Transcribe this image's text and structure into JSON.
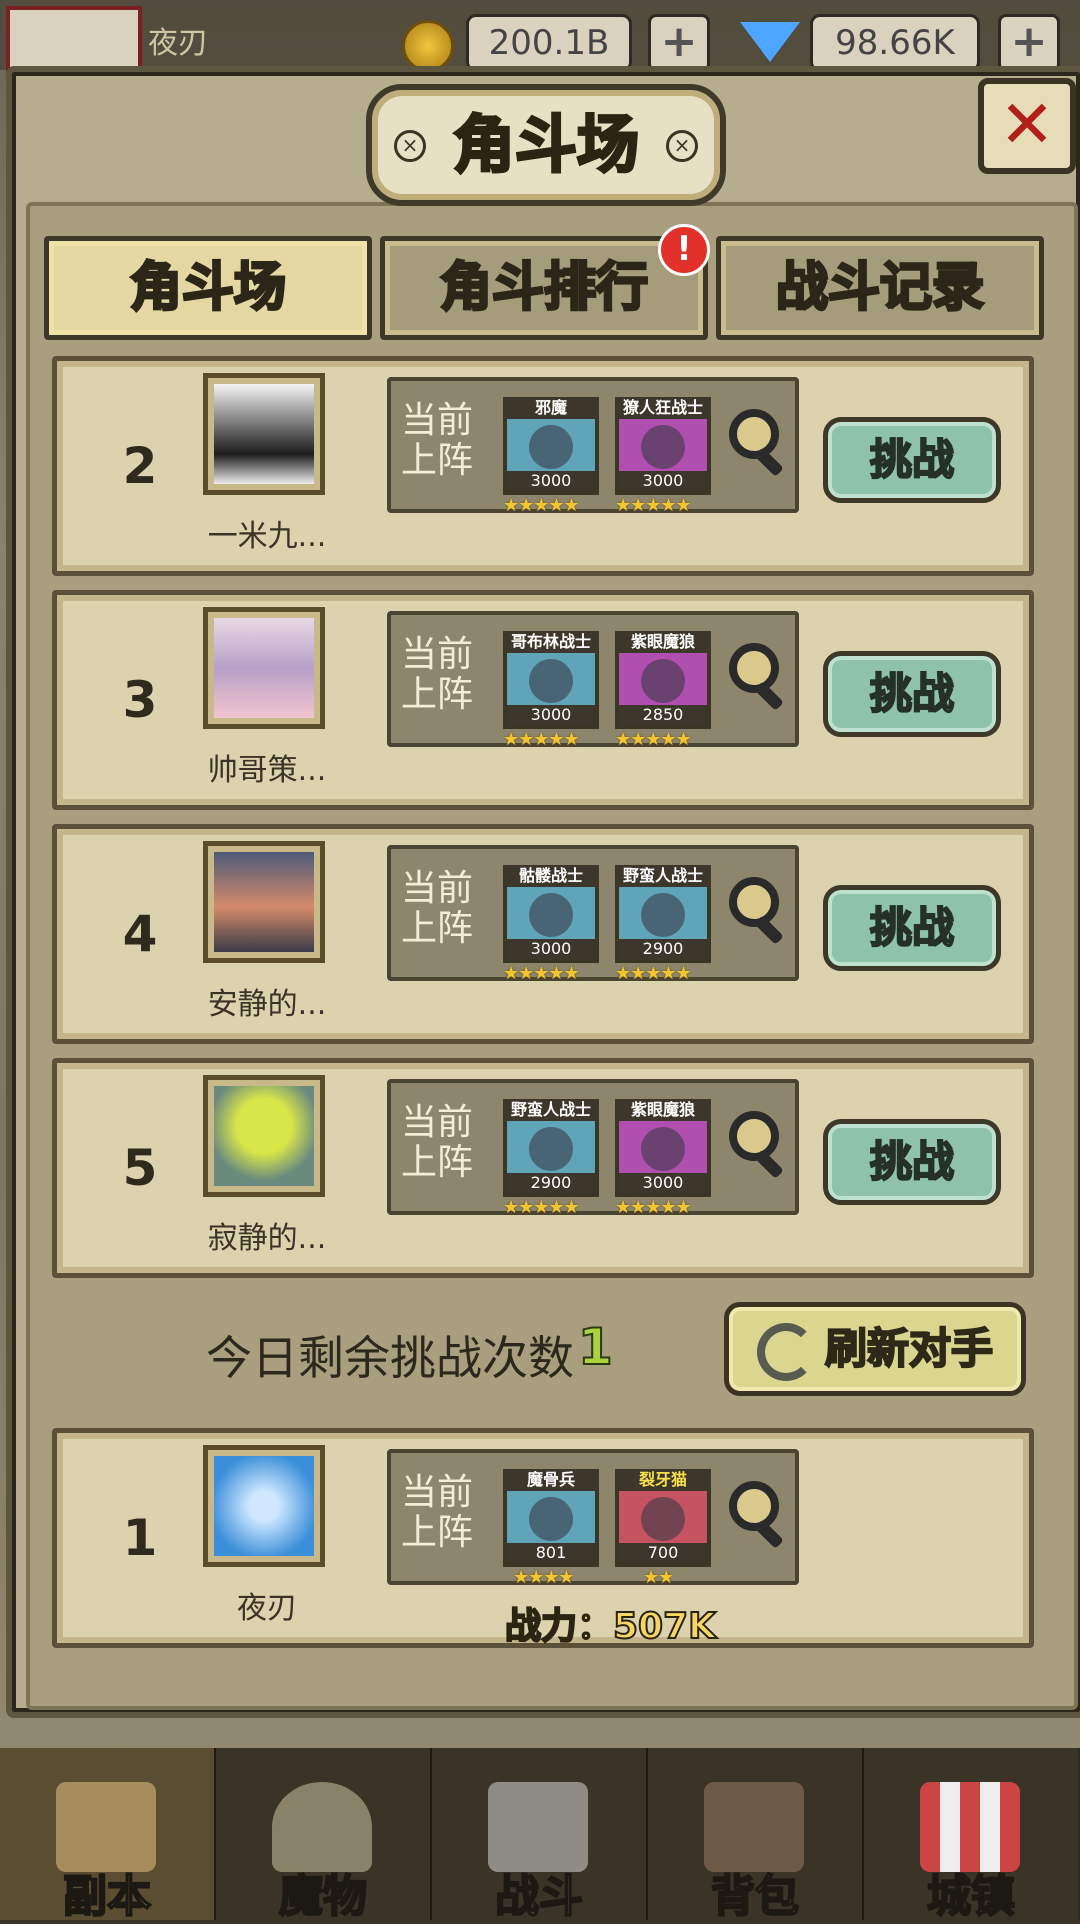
{
  "hud": {
    "player_name": "夜刃",
    "gold": "200.1B",
    "gems": "98.66K",
    "plus": "+",
    "gold_color": "#f2c63d",
    "gem_color": "#4da6ff"
  },
  "panel": {
    "title": "角斗场",
    "close_label": "✕",
    "title_dot": "×"
  },
  "tabs": [
    {
      "label": "角斗场",
      "active": true
    },
    {
      "label": "角斗排行",
      "active": false,
      "badge": "!"
    },
    {
      "label": "战斗记录",
      "active": false
    }
  ],
  "lineup_label": "当前上阵",
  "challenge_label": "挑战",
  "opponents": [
    {
      "rank": "2",
      "name": "一米九...",
      "units": [
        {
          "name": "邪魔",
          "power": "3000",
          "stars": "★★★★★"
        },
        {
          "name": "獠人狂战士",
          "power": "3000",
          "stars": "★★★★★"
        }
      ]
    },
    {
      "rank": "3",
      "name": "帅哥策...",
      "units": [
        {
          "name": "哥布林战士",
          "power": "3000",
          "stars": "★★★★★"
        },
        {
          "name": "紫眼魔狼",
          "power": "2850",
          "stars": "★★★★★"
        }
      ]
    },
    {
      "rank": "4",
      "name": "安静的...",
      "units": [
        {
          "name": "骷髅战士",
          "power": "3000",
          "stars": "★★★★★"
        },
        {
          "name": "野蛮人战士",
          "power": "2900",
          "stars": "★★★★★"
        }
      ]
    },
    {
      "rank": "5",
      "name": "寂静的...",
      "units": [
        {
          "name": "野蛮人战士",
          "power": "2900",
          "stars": "★★★★★"
        },
        {
          "name": "紫眼魔狼",
          "power": "3000",
          "stars": "★★★★★"
        }
      ]
    }
  ],
  "remaining": {
    "label": "今日剩余挑战次数",
    "count": "1"
  },
  "refresh_label": "刷新对手",
  "me": {
    "rank": "1",
    "name": "夜刃",
    "units": [
      {
        "name": "魔骨兵",
        "power": "801",
        "stars": "★★★★"
      },
      {
        "name": "裂牙猫",
        "power": "700",
        "stars": "★★"
      }
    ],
    "power": "战力：507K"
  },
  "nav": [
    {
      "label": "副本",
      "icon": "map-icon",
      "active": true
    },
    {
      "label": "魔物",
      "icon": "helmet-icon",
      "active": false
    },
    {
      "label": "战斗",
      "icon": "swords-icon",
      "active": false
    },
    {
      "label": "背包",
      "icon": "backpack-icon",
      "active": false
    },
    {
      "label": "城镇",
      "icon": "shop-icon",
      "active": false
    }
  ]
}
